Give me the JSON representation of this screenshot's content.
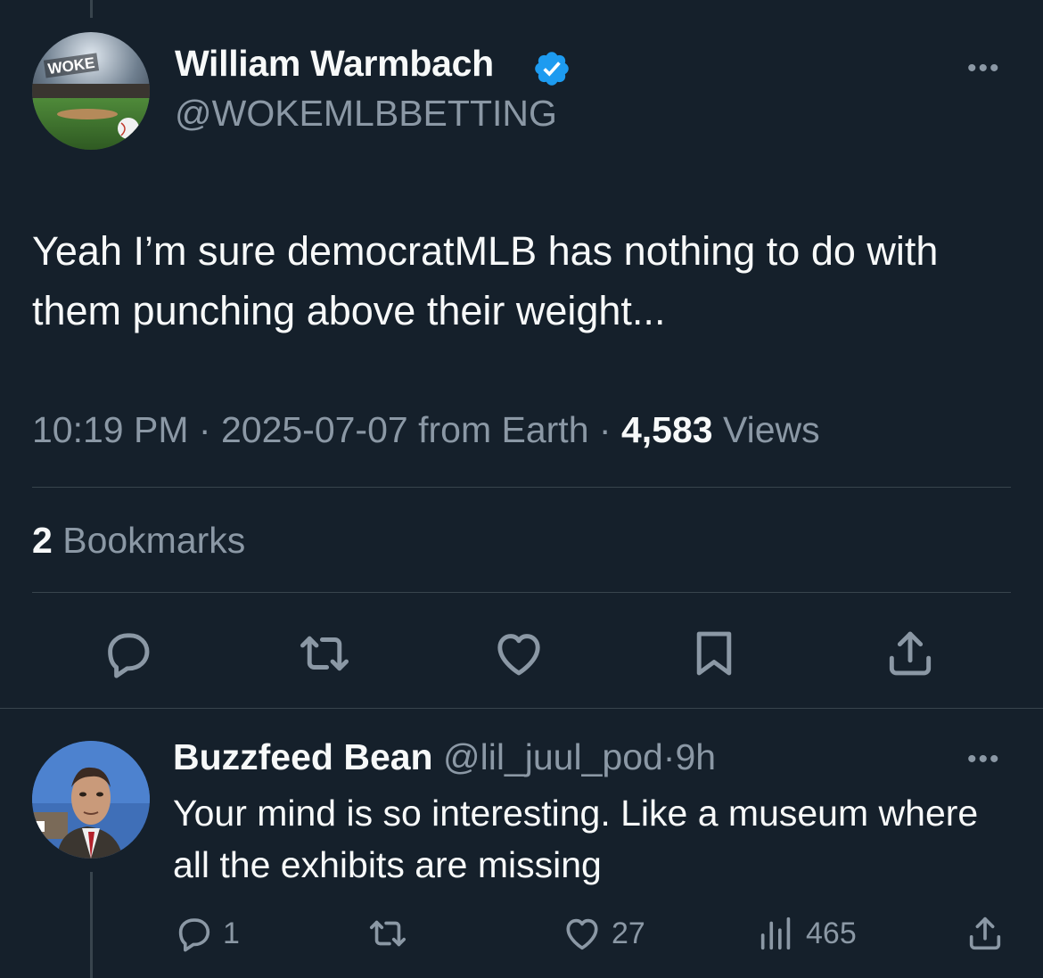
{
  "main_tweet": {
    "avatar_label": "WOKE",
    "author_name": "William Warmbach",
    "handle": "@WOKEMLBBETTING",
    "text": "Yeah I’m sure democratMLB has nothing to do with them punching above their weight...",
    "time": "10:19 PM",
    "separator": "·",
    "date": "2025-07-07",
    "source": "from Earth",
    "views_count": "4,583",
    "views_label": "Views",
    "bookmarks_count": "2",
    "bookmarks_label": "Bookmarks",
    "more_label": "•••"
  },
  "reply": {
    "author_name": "Buzzfeed Bean",
    "handle": "@lil_juul_pod",
    "separator": "·",
    "time": "9h",
    "text": "Your mind is so interesting. Like a museum where all the exhibits are missing",
    "reply_count": "1",
    "like_count": "27",
    "views_count": "465",
    "more_label": "•••"
  },
  "colors": {
    "background": "#15202b",
    "text_primary": "#f7f9f9",
    "text_secondary": "#8b98a5",
    "verified_blue": "#1d9bf0",
    "divider": "#38444d"
  },
  "icons": {
    "main_actions": [
      "reply-icon",
      "retweet-icon",
      "like-icon",
      "bookmark-icon",
      "share-icon"
    ],
    "reply_actions": [
      "reply-icon",
      "retweet-icon",
      "like-icon",
      "views-icon",
      "share-icon"
    ]
  }
}
